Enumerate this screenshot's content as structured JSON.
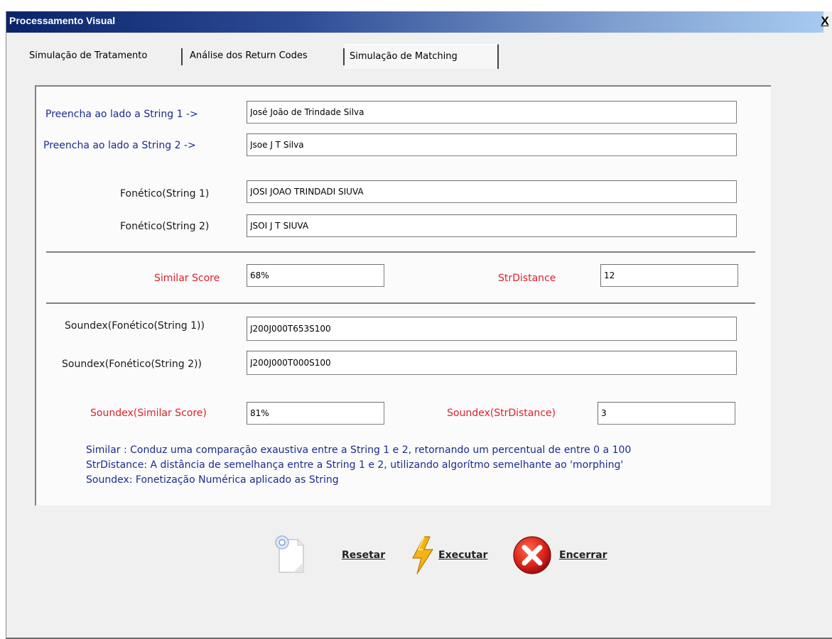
{
  "window": {
    "title": "Processamento Visual",
    "close_label": "X"
  },
  "tabs": [
    {
      "label": "Simulação de Tratamento",
      "active": false
    },
    {
      "label": "Análise dos Return Codes",
      "active": false
    },
    {
      "label": "Simulação de Matching",
      "active": true
    }
  ],
  "form": {
    "string1_label": "Preencha ao lado a String 1 ->",
    "string1_value": "José João de Trindade Silva",
    "string2_label": "Preencha ao lado a String 2 ->",
    "string2_value": "Jsoe J T Silva",
    "fon1_label": "Fonético(String 1)",
    "fon1_value": "JOSI JOAO TRINDADI SIUVA",
    "fon2_label": "Fonético(String 2)",
    "fon2_value": "JSOI J T SIUVA",
    "similar_label": "Similar Score",
    "similar_value": "68%",
    "strdist_label": "StrDistance",
    "strdist_value": "12",
    "sdx1_label": "Soundex(Fonético(String 1))",
    "sdx1_value": "J200J000T653S100",
    "sdx2_label": "Soundex(Fonético(String 2))",
    "sdx2_value": "J200J000T000S100",
    "sdx_similar_label": "Soundex(Similar Score)",
    "sdx_similar_value": "81%",
    "sdx_strdist_label": "Soundex(StrDistance)",
    "sdx_strdist_value": "3"
  },
  "info": {
    "line1": "Similar : Conduz uma comparação exaustiva entre a String 1 e 2, retornando um percentual de entre 0 a 100",
    "line2": "StrDistance: A distância de semelhança entre a String 1 e 2, utilizando algorítmo semelhante ao 'morphing'",
    "line3": "Soundex: Fonetização Numérica aplicado as String"
  },
  "buttons": {
    "reset": {
      "label": "Resetar",
      "icon": "document-icon"
    },
    "execute": {
      "label": "Executar",
      "icon": "lightning-icon"
    },
    "close": {
      "label": "Encerrar",
      "icon": "close-circle-icon"
    }
  },
  "colors": {
    "label_blue": "#1a2c8c",
    "label_red": "#e0202a",
    "title_gradient_start": "#0a246a"
  }
}
